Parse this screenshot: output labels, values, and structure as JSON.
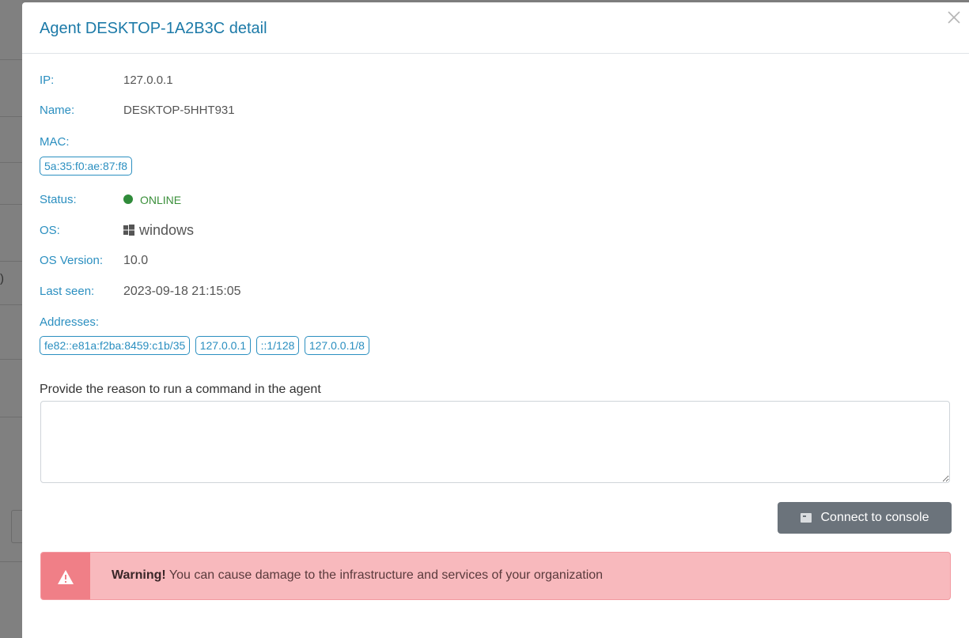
{
  "modal": {
    "title": "Agent DESKTOP-1A2B3C detail",
    "close_icon": "close-icon"
  },
  "backdrop": {
    "partial_text": ")"
  },
  "details": {
    "ip_label": "IP:",
    "ip_value": "127.0.0.1",
    "name_label": "Name:",
    "name_value": "DESKTOP-5HHT931",
    "mac_label": "MAC:",
    "mac_value": "5a:35:f0:ae:87:f8",
    "status_label": "Status:",
    "status_value": "ONLINE",
    "os_label": "OS:",
    "os_icon": "windows-icon",
    "os_value": "windows",
    "os_version_label": "OS Version:",
    "os_version_value": "10.0",
    "last_seen_label": "Last seen:",
    "last_seen_value": "2023-09-18 21:15:05",
    "addresses_label": "Addresses:",
    "addresses": [
      "fe82::e81a:f2ba:8459:c1b/35",
      "127.0.0.1",
      "::1/128",
      "127.0.0.1/8"
    ]
  },
  "command": {
    "reason_label": "Provide the reason to run a command in the agent",
    "reason_value": "",
    "connect_label": "Connect to console",
    "connect_icon": "console-icon"
  },
  "alert": {
    "icon": "warning-icon",
    "title": "Warning!",
    "message": "You can cause damage to the infrastructure and services of your organization"
  },
  "colors": {
    "accent": "#2b8fc0",
    "title": "#1c7aa8",
    "online": "#2f8b3a",
    "button": "#6b737b",
    "alert_bg": "#f8b9bd",
    "alert_icon_bg": "#f07f87"
  }
}
